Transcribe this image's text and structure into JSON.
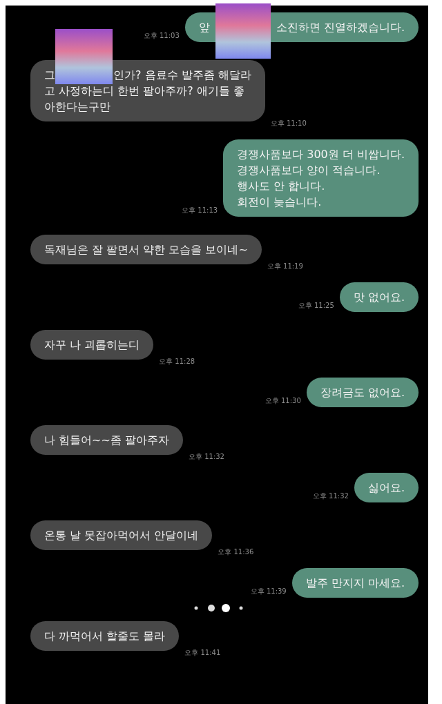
{
  "messages": [
    {
      "kind": "sent",
      "time": "오후 11:03",
      "segments": [
        {
          "kind": "text",
          "text": "앞"
        },
        {
          "kind": "censor"
        },
        {
          "kind": "text",
          "text": "소진하면 진열하겠습니다."
        }
      ]
    },
    {
      "kind": "received",
      "time": "오후 11:10",
      "segments": [
        {
          "kind": "text",
          "text": "그"
        },
        {
          "kind": "censor"
        },
        {
          "kind": "text",
          "text": "인가? 음료수 발주좀 해달라"
        },
        {
          "kind": "break"
        },
        {
          "kind": "text",
          "text": "고 사정하는디 한번 팔아주까? 애기들 좋"
        },
        {
          "kind": "break"
        },
        {
          "kind": "text",
          "text": "아한다는구만"
        }
      ]
    },
    {
      "kind": "sent",
      "time": "오후 11:13",
      "segments": [
        {
          "kind": "text",
          "text": "경쟁사품보다 300원 더 비쌉니다."
        },
        {
          "kind": "break"
        },
        {
          "kind": "text",
          "text": "경쟁사품보다 양이 적습니다."
        },
        {
          "kind": "break"
        },
        {
          "kind": "text",
          "text": "행사도 안 합니다."
        },
        {
          "kind": "break"
        },
        {
          "kind": "text",
          "text": "회전이 늦습니다."
        }
      ]
    },
    {
      "kind": "received",
      "time": "오후 11:19",
      "segments": [
        {
          "kind": "text",
          "text": "독재님은 잘 팔면서 약한 모습을 보이네~"
        }
      ]
    },
    {
      "kind": "sent",
      "time": "오후 11:25",
      "segments": [
        {
          "kind": "text",
          "text": "맛 없어요."
        }
      ]
    },
    {
      "kind": "received",
      "time": "오후 11:28",
      "segments": [
        {
          "kind": "text",
          "text": "자꾸 나 괴롭히는디"
        }
      ]
    },
    {
      "kind": "sent",
      "time": "오후 11:30",
      "segments": [
        {
          "kind": "text",
          "text": "장려금도 없어요."
        }
      ]
    },
    {
      "kind": "received",
      "time": "오후 11:32",
      "segments": [
        {
          "kind": "text",
          "text": "나 힘들어~~좀 팔아주자"
        }
      ]
    },
    {
      "kind": "sent",
      "time": "오후 11:32",
      "segments": [
        {
          "kind": "text",
          "text": "싫어요."
        }
      ]
    },
    {
      "kind": "received",
      "time": "오후 11:36",
      "segments": [
        {
          "kind": "text",
          "text": "온통 날 못잡아먹어서 안달이네"
        }
      ]
    },
    {
      "kind": "sent",
      "time": "오후 11:39",
      "segments": [
        {
          "kind": "text",
          "text": "발주 만지지 마세요."
        }
      ]
    },
    {
      "kind": "indicator"
    },
    {
      "kind": "received",
      "time": "오후 11:41",
      "segments": [
        {
          "kind": "text",
          "text": "다 까먹어서 할줄도 몰라"
        }
      ]
    }
  ]
}
